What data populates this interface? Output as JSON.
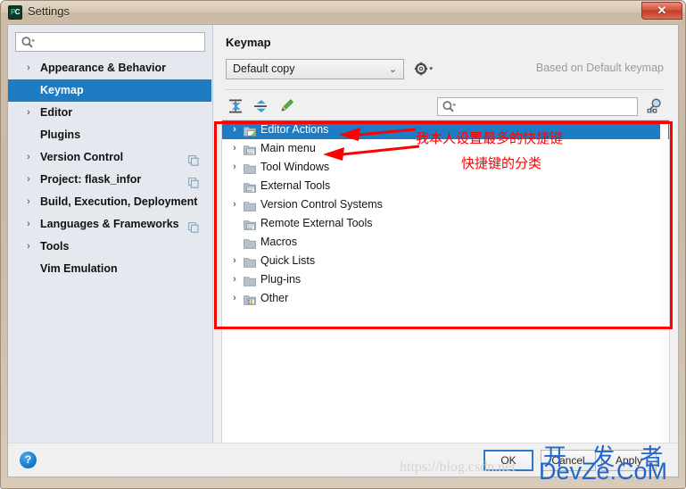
{
  "window": {
    "title": "Settings",
    "app_icon": "pycharm-icon",
    "close_label": "✕"
  },
  "sidebar": {
    "search": {
      "placeholder": "",
      "value": "",
      "icon": "search-icon"
    },
    "items": [
      {
        "label": "Appearance & Behavior",
        "expandable": true,
        "selected": false,
        "copyable": false
      },
      {
        "label": "Keymap",
        "expandable": false,
        "selected": true,
        "copyable": false
      },
      {
        "label": "Editor",
        "expandable": true,
        "selected": false,
        "copyable": false
      },
      {
        "label": "Plugins",
        "expandable": false,
        "selected": false,
        "copyable": false
      },
      {
        "label": "Version Control",
        "expandable": true,
        "selected": false,
        "copyable": true
      },
      {
        "label": "Project: flask_infor",
        "expandable": true,
        "selected": false,
        "copyable": true
      },
      {
        "label": "Build, Execution, Deployment",
        "expandable": true,
        "selected": false,
        "copyable": false
      },
      {
        "label": "Languages & Frameworks",
        "expandable": true,
        "selected": false,
        "copyable": true
      },
      {
        "label": "Tools",
        "expandable": true,
        "selected": false,
        "copyable": false
      },
      {
        "label": "Vim Emulation",
        "expandable": false,
        "selected": false,
        "copyable": false
      }
    ]
  },
  "panel": {
    "title": "Keymap",
    "keymap_select": {
      "value": "Default copy",
      "chevron": "⌄"
    },
    "gear_icon": "gear-icon",
    "based_on": "Based on Default keymap",
    "toolbar": {
      "expand_all": "expand-all-icon",
      "collapse_all": "collapse-all-icon",
      "edit": "edit-pencil-icon",
      "find_shortcut": "find-by-shortcut-icon"
    },
    "tree_search": {
      "placeholder": "",
      "value": "",
      "icon": "search-icon"
    }
  },
  "action_tree": {
    "rows": [
      {
        "label": "Editor Actions",
        "expandable": true,
        "selected": true,
        "icon": "folder-editor-icon"
      },
      {
        "label": "Main menu",
        "expandable": true,
        "selected": false,
        "icon": "folder-menu-icon"
      },
      {
        "label": "Tool Windows",
        "expandable": true,
        "selected": false,
        "icon": "folder-icon"
      },
      {
        "label": "External Tools",
        "expandable": false,
        "selected": false,
        "icon": "folder-tools-icon"
      },
      {
        "label": "Version Control Systems",
        "expandable": true,
        "selected": false,
        "icon": "folder-icon"
      },
      {
        "label": "Remote External Tools",
        "expandable": false,
        "selected": false,
        "icon": "folder-tools-icon"
      },
      {
        "label": "Macros",
        "expandable": false,
        "selected": false,
        "icon": "folder-icon"
      },
      {
        "label": "Quick Lists",
        "expandable": true,
        "selected": false,
        "icon": "folder-icon"
      },
      {
        "label": "Plug-ins",
        "expandable": true,
        "selected": false,
        "icon": "folder-icon"
      },
      {
        "label": "Other",
        "expandable": true,
        "selected": false,
        "icon": "folder-other-icon"
      }
    ]
  },
  "annotations": {
    "color": "#ff0000",
    "text_1": "我本人设置最多的快捷键",
    "text_2": "快捷键的分类"
  },
  "footer": {
    "help": "?",
    "ok": "OK",
    "cancel": "Cancel",
    "apply": "Apply"
  },
  "watermarks": {
    "url": "https://blog.csdn.net",
    "cn": "开 发 者",
    "site": "DevZe.CoM"
  }
}
